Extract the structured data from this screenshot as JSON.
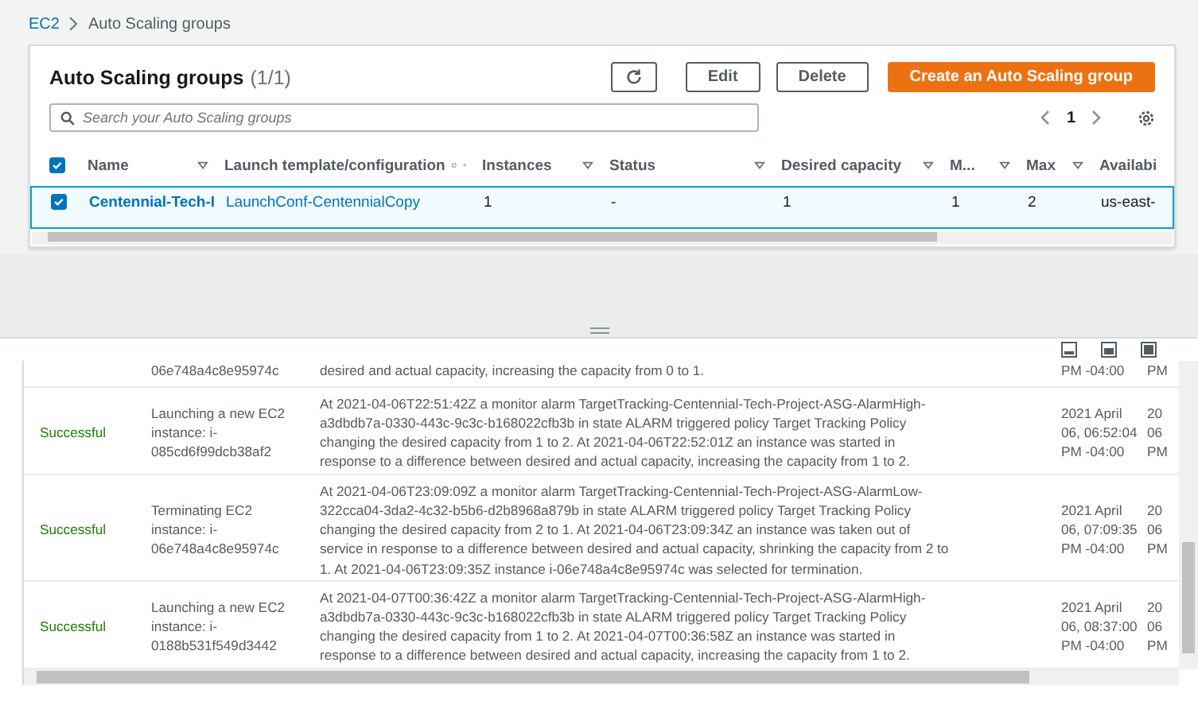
{
  "breadcrumb": [
    {
      "label": "EC2",
      "link": true
    },
    {
      "label": "Auto Scaling groups",
      "link": false
    }
  ],
  "groups": {
    "title": "Auto Scaling groups",
    "count": "(1/1)",
    "buttons": [
      {
        "label": "Edit",
        "kind": "normal"
      },
      {
        "label": "Delete",
        "kind": "normal"
      },
      {
        "label": "Create an Auto Scaling group",
        "kind": "primary"
      }
    ],
    "search": {
      "placeholder": "Search your Auto Scaling groups"
    },
    "page": "1",
    "columns": [
      {
        "label": "Name",
        "external": false,
        "filter": true
      },
      {
        "label": "Launch template/configuration",
        "external": true,
        "filter": true
      },
      {
        "label": "Instances",
        "external": false,
        "filter": true
      },
      {
        "label": "Status",
        "external": false,
        "filter": true
      },
      {
        "label": "Desired capacity",
        "external": false,
        "filter": true
      },
      {
        "label": "M...",
        "external": false,
        "filter": true
      },
      {
        "label": "Max",
        "external": false,
        "filter": true
      },
      {
        "label": "Availabi",
        "external": false
      }
    ],
    "header_checked": true,
    "rows": [
      {
        "selected": true,
        "cells": [
          "Centennial-Tech-I",
          "LaunchConf-CentennialCopy",
          "1",
          "-",
          "1",
          "1",
          "2",
          "us-east-"
        ]
      }
    ]
  },
  "activity": {
    "rows": [
      {
        "status": "",
        "description": [
          "06e748a4c8e95974c"
        ],
        "cause": [
          "desired and actual capacity, increasing the capacity from 0 to 1."
        ],
        "time": [
          "PM -04:00"
        ],
        "column_5": [
          "PM"
        ]
      },
      {
        "status": "Successful",
        "description": [
          "Launching a new EC2",
          "instance: i-",
          "085cd6f99dcb38af2"
        ],
        "cause": [
          "At 2021-04-06T22:51:42Z a monitor alarm TargetTracking-Centennial-Tech-Project-ASG-AlarmHigh-",
          "a3dbdb7a-0330-443c-9c3c-b168022cfb3b in state ALARM triggered policy Target Tracking Policy",
          "changing the desired capacity from 1 to 2. At 2021-04-06T22:52:01Z an instance was started in",
          "response to a difference between desired and actual capacity, increasing the capacity from 1 to 2."
        ],
        "time": [
          "2021 April",
          "06, 06:52:04",
          "PM -04:00"
        ],
        "column_5": [
          "20",
          "06",
          "PM"
        ]
      },
      {
        "status": "Successful",
        "description": [
          "Terminating EC2",
          "instance: i-",
          "06e748a4c8e95974c"
        ],
        "cause": [
          "At 2021-04-06T23:09:09Z a monitor alarm TargetTracking-Centennial-Tech-Project-ASG-AlarmLow-",
          "322cca04-3da2-4c32-b5b6-d2b8968a879b in state ALARM triggered policy Target Tracking Policy",
          "changing the desired capacity from 2 to 1. At 2021-04-06T23:09:34Z an instance was taken out of",
          "service in response to a difference between desired and actual capacity, shrinking the capacity from 2 to",
          "1. At 2021-04-06T23:09:35Z instance i-06e748a4c8e95974c was selected for termination."
        ],
        "time": [
          "2021 April",
          "06, 07:09:35",
          "PM -04:00"
        ],
        "column_5": [
          "20",
          "06",
          "PM"
        ]
      },
      {
        "status": "Successful",
        "description": [
          "Launching a new EC2",
          "instance: i-",
          "0188b531f549d3442"
        ],
        "cause": [
          "At 2021-04-07T00:36:42Z a monitor alarm TargetTracking-Centennial-Tech-Project-ASG-AlarmHigh-",
          "a3dbdb7a-0330-443c-9c3c-b168022cfb3b in state ALARM triggered policy Target Tracking Policy",
          "changing the desired capacity from 1 to 2. At 2021-04-07T00:36:58Z an instance was started in",
          "response to a difference between desired and actual capacity, increasing the capacity from 1 to 2."
        ],
        "time": [
          "2021 April",
          "06, 08:37:00",
          "PM -04:00"
        ],
        "column_5": [
          "20",
          "06",
          "PM"
        ]
      }
    ]
  }
}
